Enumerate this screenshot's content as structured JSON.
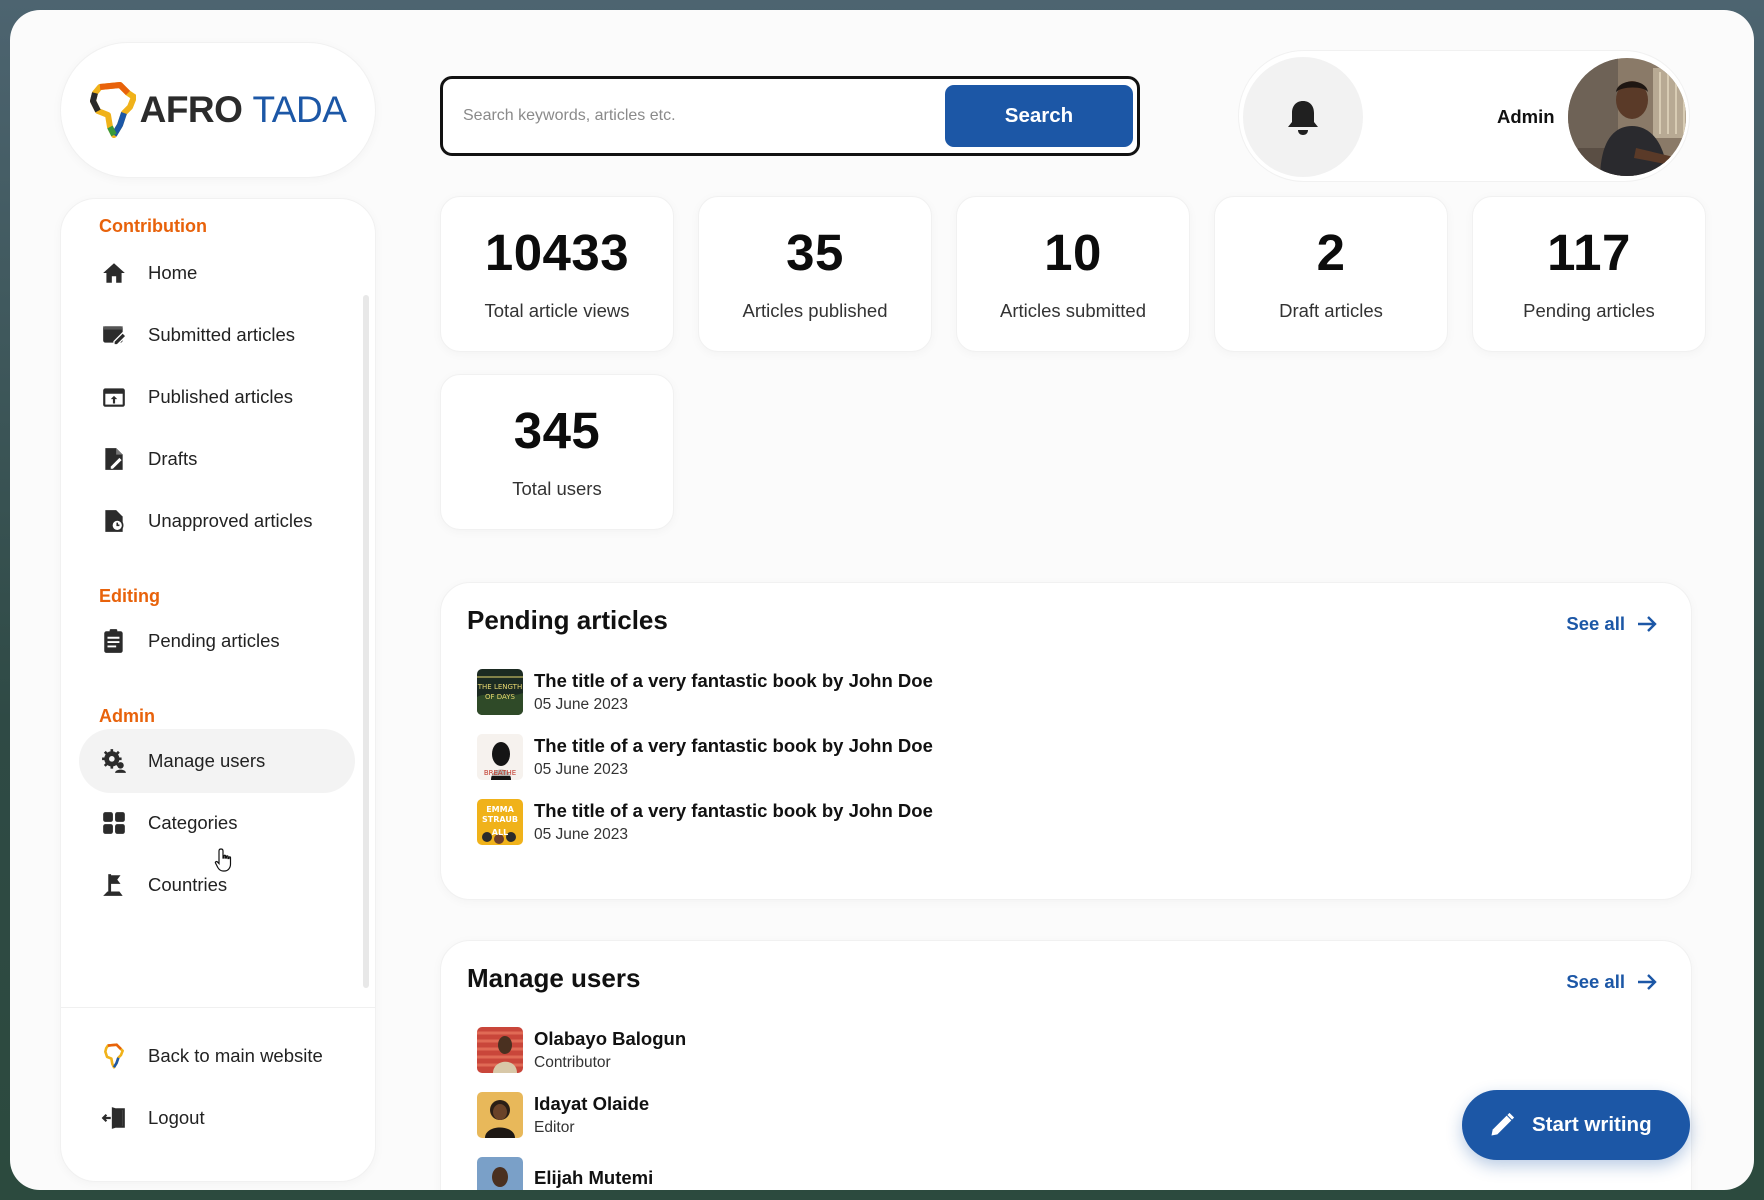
{
  "brand": {
    "word1": "AFRO",
    "word2": "TADA"
  },
  "search": {
    "placeholder": "Search keywords, articles etc.",
    "button_label": "Search"
  },
  "header": {
    "user_name": "Admin"
  },
  "sidebar": {
    "sections": [
      {
        "title": "Contribution"
      },
      {
        "title": "Editing"
      },
      {
        "title": "Admin"
      }
    ],
    "items": [
      {
        "label": "Home",
        "icon": "home-icon"
      },
      {
        "label": "Submitted articles",
        "icon": "edit-document-icon"
      },
      {
        "label": "Published articles",
        "icon": "upload-window-icon"
      },
      {
        "label": "Drafts",
        "icon": "draft-file-icon"
      },
      {
        "label": "Unapproved articles",
        "icon": "clock-file-icon"
      },
      {
        "label": "Pending articles",
        "icon": "clipboard-list-icon"
      },
      {
        "label": "Manage users",
        "icon": "user-gear-icon",
        "active": true
      },
      {
        "label": "Categories",
        "icon": "grid-icon"
      },
      {
        "label": "Countries",
        "icon": "flag-icon"
      }
    ],
    "bottom": [
      {
        "label": "Back to main website",
        "icon": "afrotada-logo-icon"
      },
      {
        "label": "Logout",
        "icon": "logout-icon"
      }
    ]
  },
  "stats": [
    {
      "value": "10433",
      "label": "Total article views"
    },
    {
      "value": "35",
      "label": "Articles published"
    },
    {
      "value": "10",
      "label": "Articles submitted"
    },
    {
      "value": "2",
      "label": "Draft articles"
    },
    {
      "value": "117",
      "label": "Pending articles"
    },
    {
      "value": "345",
      "label": "Total users"
    }
  ],
  "pending": {
    "title": "Pending articles",
    "see_all": "See all",
    "rows": [
      {
        "title": "The title of  a very fantastic book by John Doe",
        "date": "05 June 2023",
        "cover_text": "THE LENGTH OF DAYS",
        "cover_color": "#1c2b22"
      },
      {
        "title": "The title of  a very fantastic book by John Doe",
        "date": "05 June 2023",
        "cover_text": "BREATHE",
        "cover_color": "#f6f2ee"
      },
      {
        "title": "The title of  a very fantastic book by John Doe",
        "date": "05 June 2023",
        "cover_text": "EMMA STRAUB ALL",
        "cover_color": "#f0b21a"
      }
    ]
  },
  "users": {
    "title": "Manage users",
    "see_all": "See all",
    "rows": [
      {
        "name": "Olabayo Balogun",
        "role": "Contributor"
      },
      {
        "name": "Idayat Olaide",
        "role": "Editor"
      },
      {
        "name": "Elijah Mutemi",
        "role": ""
      }
    ]
  },
  "fab": {
    "label": "Start writing"
  },
  "colors": {
    "accent": "#1c57a6",
    "section_heading": "#e8620b"
  }
}
